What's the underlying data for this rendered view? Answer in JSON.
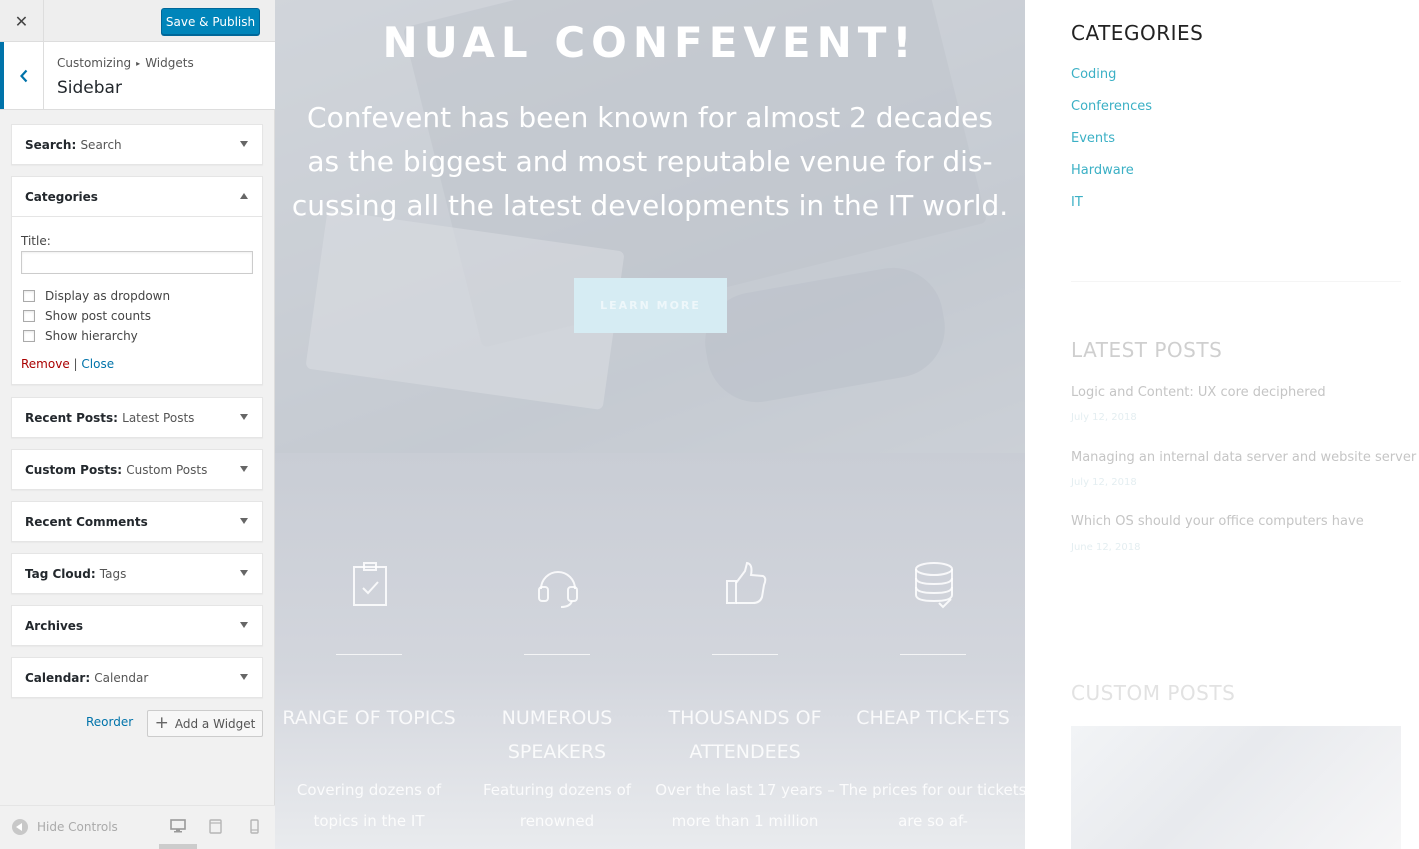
{
  "customizer": {
    "close_glyph": "✕",
    "save_label": "Save & Publish",
    "breadcrumb": {
      "parent": "Customizing",
      "separator": "▸",
      "current": "Widgets"
    },
    "section_title": "Sidebar",
    "widgets": [
      {
        "title": "Search",
        "instance": "Search",
        "expanded": false
      },
      {
        "title": "Categories",
        "instance": "",
        "expanded": true
      },
      {
        "title": "Recent Posts",
        "instance": "Latest Posts",
        "expanded": false
      },
      {
        "title": "Custom Posts",
        "instance": "Custom Posts",
        "expanded": false
      },
      {
        "title": "Recent Comments",
        "instance": "",
        "expanded": false
      },
      {
        "title": "Tag Cloud",
        "instance": "Tags",
        "expanded": false
      },
      {
        "title": "Archives",
        "instance": "",
        "expanded": false
      },
      {
        "title": "Calendar",
        "instance": "Calendar",
        "expanded": false
      }
    ],
    "categories_form": {
      "title_label": "Title:",
      "title_value": "",
      "options": [
        {
          "label": "Display as dropdown",
          "checked": false
        },
        {
          "label": "Show post counts",
          "checked": false
        },
        {
          "label": "Show hierarchy",
          "checked": false
        }
      ],
      "remove_label": "Remove",
      "divider": "|",
      "close_label": "Close"
    },
    "reorder_label": "Reorder",
    "add_widget_label": "Add a Widget",
    "footer": {
      "hide_controls_label": "Hide Controls",
      "devices": [
        "desktop",
        "tablet",
        "mobile"
      ],
      "active_device": "desktop"
    }
  },
  "preview": {
    "hero": {
      "title": "NUAL CONFEVENT!",
      "text": "Confevent has been known for almost 2 decades as the biggest and most reputable venue for dis-cussing all the latest developments in the IT world.",
      "button_label": "LEARN MORE"
    },
    "features": [
      {
        "icon": "clipboard-check-icon",
        "title": "RANGE OF TOPICS",
        "text": "Covering dozens of topics in the IT"
      },
      {
        "icon": "headset-icon",
        "title": "NUMEROUS SPEAKERS",
        "text": "Featuring dozens of renowned"
      },
      {
        "icon": "thumbs-up-icon",
        "title": "THOUSANDS OF ATTENDEES",
        "text": "Over the last 17 years – more than 1 million"
      },
      {
        "icon": "database-icon",
        "title": "CHEAP TICK-ETS",
        "text": "The prices for our tickets are so af-"
      }
    ],
    "sidebar": {
      "categories_heading": "CATEGORIES",
      "categories": [
        "Coding",
        "Conferences",
        "Events",
        "Hardware",
        "IT"
      ],
      "latest_posts_heading": "LATEST POSTS",
      "latest_posts": [
        {
          "title": "Logic and Content: UX core deciphered",
          "date": "July 12, 2018"
        },
        {
          "title": "Managing an internal data server and website server",
          "date": "July 12, 2018"
        },
        {
          "title": "Which OS should your office computers have",
          "date": "June 12, 2018"
        }
      ],
      "custom_posts_heading": "CUSTOM POSTS"
    },
    "colors": {
      "accent": "#3bb0c5",
      "wp_blue": "#0085ba",
      "link_red": "#aa0000"
    }
  }
}
